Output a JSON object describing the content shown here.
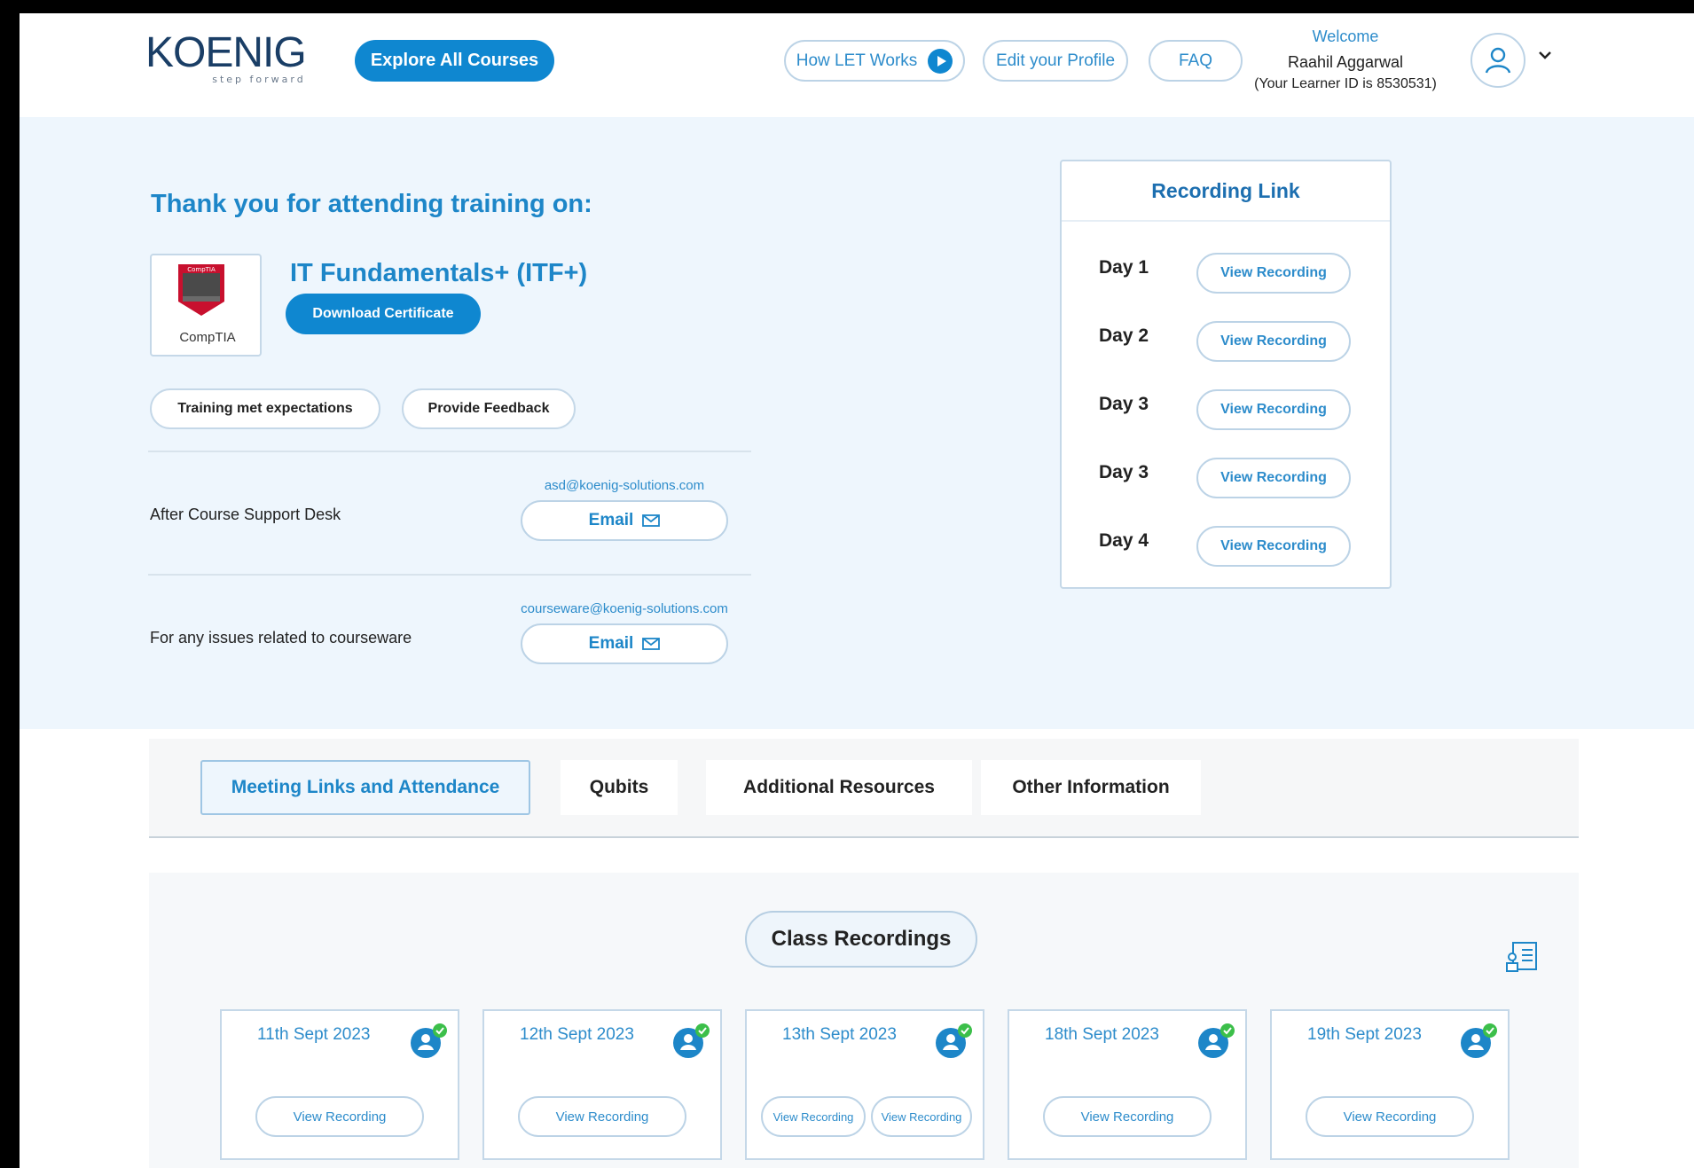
{
  "header": {
    "logo_text": "KOENIG",
    "logo_tagline": "step forward",
    "explore_label": "Explore All Courses",
    "how_label": "How LET Works",
    "edit_label": "Edit your Profile",
    "faq_label": "FAQ",
    "welcome": "Welcome",
    "user_name": "Raahil Aggarwal",
    "learner_id": "(Your Learner ID is 8530531)"
  },
  "hero": {
    "thank_you": "Thank you for attending training on:",
    "vendor_badge_text": "CompTIA",
    "vendor_name": "CompTIA",
    "course_title": "IT Fundamentals+ (ITF+)",
    "download_label": "Download Certificate",
    "expectations_label": "Training met expectations",
    "feedback_label": "Provide Feedback",
    "support": [
      {
        "label": "After Course Support Desk",
        "email": "asd@koenig-solutions.com",
        "button": "Email"
      },
      {
        "label": "For any issues related to courseware",
        "email": "courseware@koenig-solutions.com",
        "button": "Email"
      }
    ]
  },
  "recording_panel": {
    "title": "Recording Link",
    "rows": [
      {
        "day": "Day 1",
        "button": "View Recording"
      },
      {
        "day": "Day 2",
        "button": "View Recording"
      },
      {
        "day": "Day 3",
        "button": "View Recording"
      },
      {
        "day": "Day 3",
        "button": "View Recording"
      },
      {
        "day": "Day 4",
        "button": "View Recording"
      }
    ]
  },
  "tabs": [
    {
      "label": "Meeting Links and Attendance",
      "active": true
    },
    {
      "label": "Qubits",
      "active": false
    },
    {
      "label": "Additional Resources",
      "active": false
    },
    {
      "label": "Other Information",
      "active": false
    }
  ],
  "class_recordings": {
    "title": "Class Recordings",
    "cards": [
      {
        "date": "11th Sept 2023",
        "buttons": [
          "View Recording"
        ]
      },
      {
        "date": "12th Sept 2023",
        "buttons": [
          "View Recording"
        ]
      },
      {
        "date": "13th Sept 2023",
        "buttons": [
          "View Recording",
          "View Recording"
        ]
      },
      {
        "date": "18th Sept 2023",
        "buttons": [
          "View Recording"
        ]
      },
      {
        "date": "19th Sept 2023",
        "buttons": [
          "View Recording"
        ]
      }
    ]
  },
  "colors": {
    "primary": "#0f87d0",
    "accent_text": "#1d86c8",
    "hero_bg": "#eef6fd",
    "border": "#c5d8e8",
    "check_green": "#3cbf4a"
  }
}
